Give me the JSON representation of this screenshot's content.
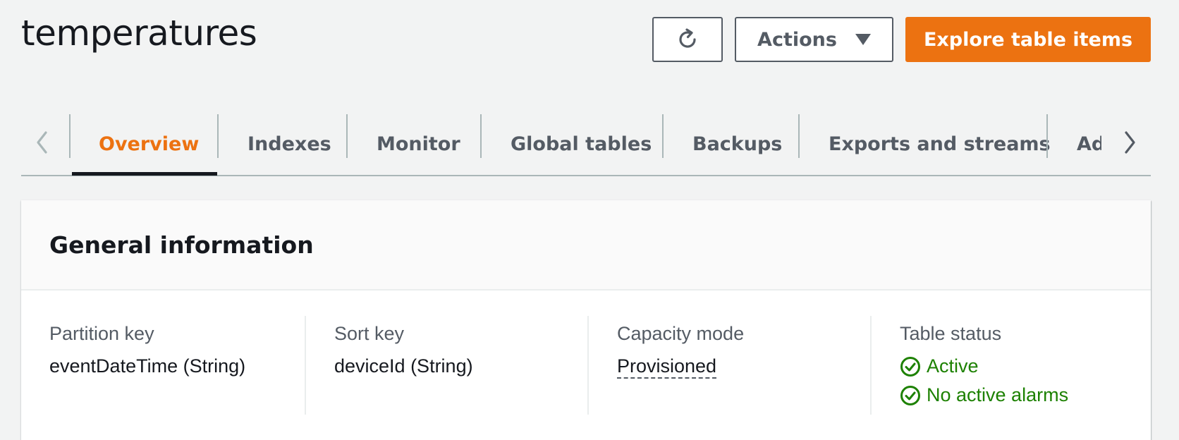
{
  "header": {
    "title": "temperatures",
    "actions_label": "Actions",
    "explore_label": "Explore table items"
  },
  "tabs": [
    {
      "label": "Overview"
    },
    {
      "label": "Indexes"
    },
    {
      "label": "Monitor"
    },
    {
      "label": "Global tables"
    },
    {
      "label": "Backups"
    },
    {
      "label": "Exports and streams"
    },
    {
      "label": "Ad"
    }
  ],
  "general": {
    "title": "General information",
    "partition_key": {
      "label": "Partition key",
      "value": "eventDateTime (String)"
    },
    "sort_key": {
      "label": "Sort key",
      "value": "deviceId (String)"
    },
    "capacity_mode": {
      "label": "Capacity mode",
      "value": "Provisioned"
    },
    "table_status": {
      "label": "Table status",
      "status": "Active",
      "alarms": "No active alarms"
    }
  },
  "colors": {
    "accent": "#ec7211",
    "success": "#1d8102",
    "text": "#16191f",
    "muted": "#545b64"
  },
  "icons": {
    "refresh": "refresh-icon",
    "caret": "caret-down-icon",
    "tab_prev": "chevron-left-icon",
    "tab_next": "chevron-right-icon",
    "status_ok": "check-circle-icon"
  }
}
